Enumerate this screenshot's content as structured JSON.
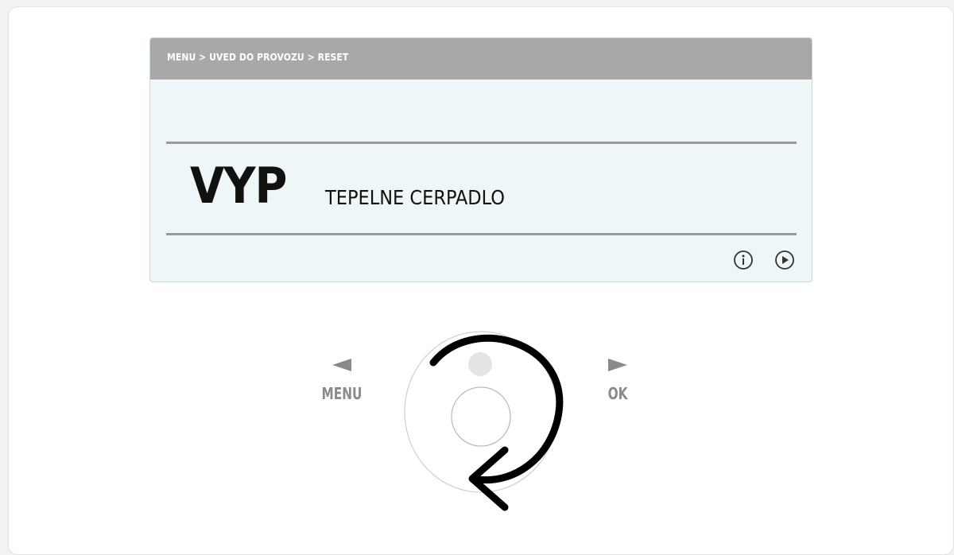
{
  "breadcrumb": "MENU > UVED DO PROVOZU > RESET",
  "display": {
    "value": "VYP",
    "label": "TEPELNE CERPADLO",
    "icons": [
      "info-icon",
      "play-icon"
    ]
  },
  "nav": {
    "left_label": "MENU",
    "right_label": "OK"
  },
  "colors": {
    "header": "#a8a8a8",
    "lcd_background": "#eef6f7",
    "text": "#111111",
    "nav_text": "#8a8a8a",
    "rotate_arrow": "#000000"
  }
}
